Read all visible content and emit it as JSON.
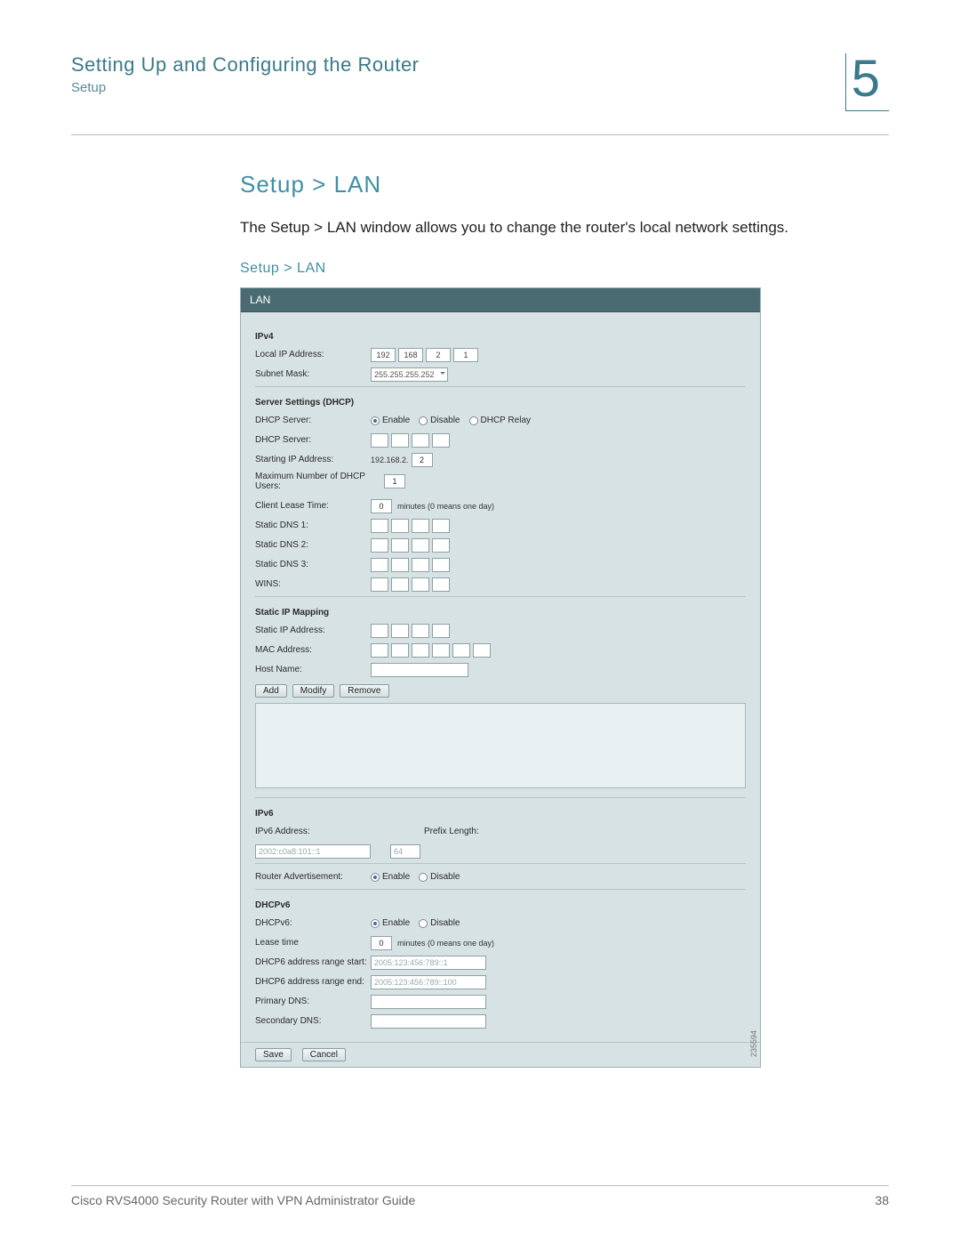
{
  "header": {
    "chapter_title": "Setting Up and Configuring the Router",
    "chapter_subtitle": "Setup",
    "chapter_number": "5"
  },
  "section": {
    "heading": "Setup > LAN",
    "description": "The Setup > LAN window allows you to change the router's local network settings.",
    "panel_caption": "Setup > LAN"
  },
  "screenshot": {
    "title_bar": "LAN",
    "ipv4_heading": "IPv4",
    "local_ip_label": "Local IP Address:",
    "local_ip": [
      "192",
      "168",
      "2",
      "1"
    ],
    "subnet_mask_label": "Subnet Mask:",
    "subnet_mask_value": "255.255.255.252",
    "server_settings_heading": "Server Settings (DHCP)",
    "dhcp_server_label": "DHCP Server:",
    "dhcp_options": {
      "enable": "Enable",
      "disable": "Disable",
      "relay": "DHCP Relay"
    },
    "dhcp_server2_label": "DHCP Server:",
    "starting_ip_label": "Starting IP Address:",
    "starting_ip_prefix": "192.168.2.",
    "starting_ip_value": "2",
    "max_users_label": "Maximum Number of DHCP Users:",
    "max_users_value": "1",
    "client_lease_label": "Client Lease Time:",
    "client_lease_value": "0",
    "lease_suffix": "minutes (0 means one day)",
    "static_dns1_label": "Static DNS 1:",
    "static_dns2_label": "Static DNS 2:",
    "static_dns3_label": "Static DNS 3:",
    "wins_label": "WINS:",
    "static_ip_mapping_heading": "Static IP Mapping",
    "static_ip_addr_label": "Static IP Address:",
    "mac_addr_label": "MAC Address:",
    "host_name_label": "Host Name:",
    "btn_add": "Add",
    "btn_modify": "Modify",
    "btn_remove": "Remove",
    "ipv6_heading": "IPv6",
    "ipv6_addr_label": "IPv6 Address:",
    "ipv6_addr_value": "2002:c0a8:101::1",
    "prefix_len_label": "Prefix Length:",
    "prefix_len_value": "64",
    "router_adv_label": "Router Advertisement:",
    "dhcpv6_heading": "DHCPv6",
    "dhcpv6_label": "DHCPv6:",
    "lease_time_label": "Lease time",
    "lease_time_value": "0",
    "dhcp6_range_start_label": "DHCP6 address range start:",
    "dhcp6_range_start_value": "2005:123:456:789::1",
    "dhcp6_range_end_label": "DHCP6 address range end:",
    "dhcp6_range_end_value": "2005:123:456:789::100",
    "primary_dns_label": "Primary DNS:",
    "secondary_dns_label": "Secondary DNS:",
    "btn_save": "Save",
    "btn_cancel": "Cancel",
    "watermark": "235594"
  },
  "footer": {
    "doc_title": "Cisco RVS4000 Security Router with VPN Administrator Guide",
    "page_number": "38"
  }
}
